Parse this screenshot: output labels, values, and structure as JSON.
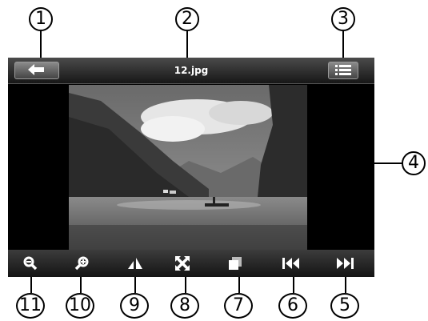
{
  "window": {
    "title": "12.jpg"
  },
  "topbar": {
    "back_icon": "arrow-left-icon",
    "menu_icon": "list-icon"
  },
  "toolbar": {
    "items": [
      {
        "icon": "zoom-out-icon"
      },
      {
        "icon": "zoom-in-icon"
      },
      {
        "icon": "rotate-icon"
      },
      {
        "icon": "fullscreen-icon"
      },
      {
        "icon": "slideshow-icon"
      },
      {
        "icon": "previous-icon"
      },
      {
        "icon": "next-icon"
      }
    ]
  },
  "callouts": {
    "c1": "1",
    "c2": "2",
    "c3": "3",
    "c4": "4",
    "c5": "5",
    "c6": "6",
    "c7": "7",
    "c8": "8",
    "c9": "9",
    "c10": "10",
    "c11": "11"
  },
  "colors": {
    "screen_bg": "#000000",
    "bar_top": "#4b4b4b",
    "bar_bottom": "#171717"
  }
}
